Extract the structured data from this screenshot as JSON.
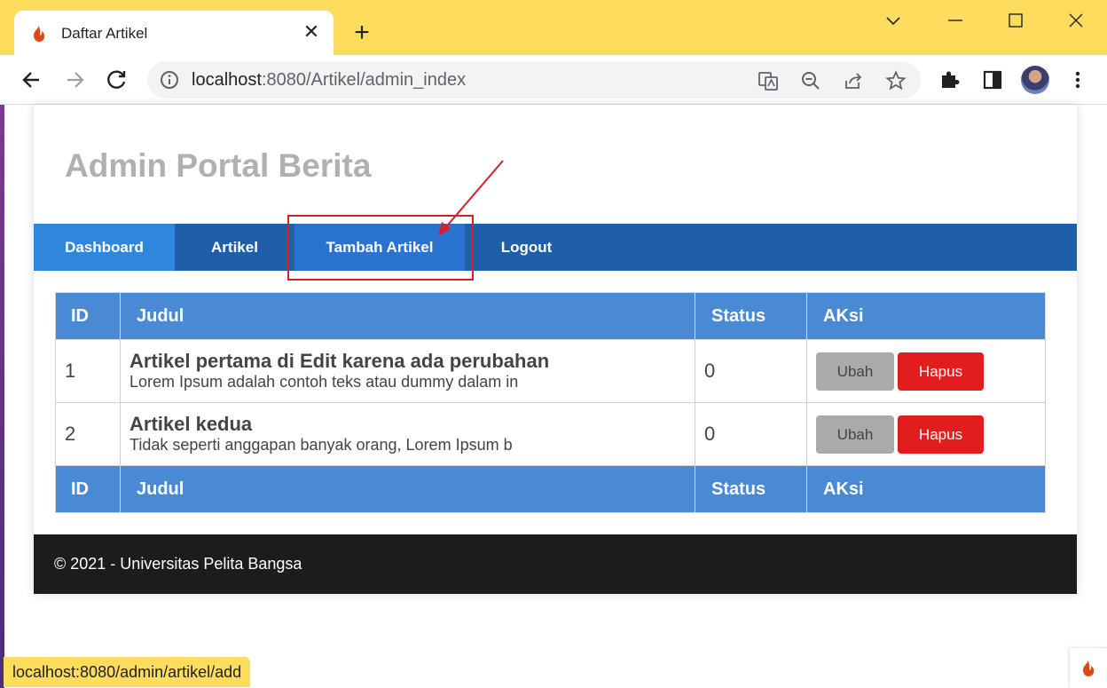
{
  "browser": {
    "tab_title": "Daftar Artikel",
    "url_host": "localhost",
    "url_path": ":8080/Artikel/admin_index",
    "status_url": "localhost:8080/admin/artikel/add"
  },
  "site": {
    "title": "Admin Portal Berita",
    "nav": [
      "Dashboard",
      "Artikel",
      "Tambah Artikel",
      "Logout"
    ]
  },
  "table": {
    "headers": [
      "ID",
      "Judul",
      "Status",
      "AKsi"
    ],
    "rows": [
      {
        "id": "1",
        "title": "Artikel pertama di Edit karena ada perubahan",
        "desc": "Lorem Ipsum adalah contoh teks atau dummy dalam in",
        "status": "0"
      },
      {
        "id": "2",
        "title": "Artikel kedua",
        "desc": "Tidak seperti anggapan banyak orang, Lorem Ipsum b",
        "status": "0"
      }
    ],
    "edit_label": "Ubah",
    "delete_label": "Hapus"
  },
  "footer": {
    "text": "© 2021 - Universitas Pelita Bangsa"
  },
  "colors": {
    "nav": "#1f5fa8",
    "nav_active": "#2f86dd",
    "table_header": "#4a8ad5",
    "delete": "#e21d1d",
    "annotation": "#d3202a"
  }
}
